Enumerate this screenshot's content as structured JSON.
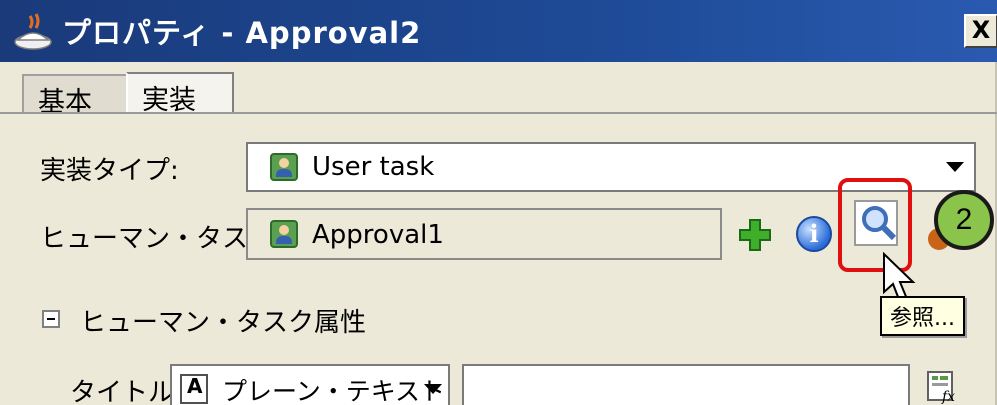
{
  "window": {
    "title": "プロパティ - Approval2",
    "close_label": "X"
  },
  "tabs": [
    {
      "label": "基本"
    },
    {
      "label": "実装"
    }
  ],
  "form": {
    "impl_type_label": "実装タイプ:",
    "impl_type_value": "User task",
    "human_task_label": "ヒューマン・タスク:",
    "human_task_value": "Approval1",
    "browse_tooltip": "参照...",
    "step_number": "2",
    "section_label": "ヒューマン・タスク属性",
    "title_label": "タイトル:",
    "title_mode_value": "プレーン・テキスト",
    "title_input_value": ""
  }
}
